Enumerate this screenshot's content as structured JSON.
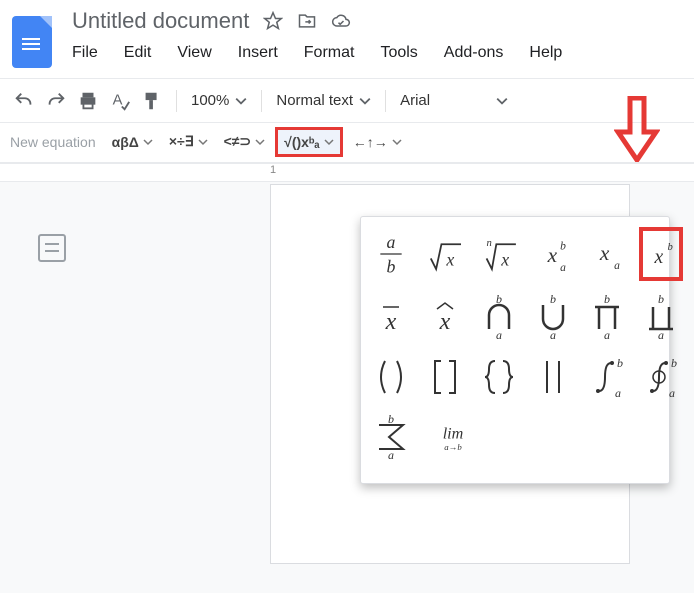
{
  "header": {
    "title": "Untitled document",
    "menu": [
      "File",
      "Edit",
      "View",
      "Insert",
      "Format",
      "Tools",
      "Add-ons",
      "Help"
    ]
  },
  "toolbar": {
    "zoom": "100%",
    "paragraph_style": "Normal text",
    "font": "Arial"
  },
  "equation_toolbar": {
    "new_equation": "New equation",
    "greek": "αβΔ",
    "operators": "×÷∃",
    "relations": "<≠⊃",
    "math_group": "√()xᵇₐ",
    "arrows": "←↑→"
  },
  "ruler": {
    "mark": "1"
  },
  "math_dropdown": {
    "row1": [
      "frac_ab",
      "sqrt_x",
      "nthroot_x",
      "x_sub_sup",
      "x_sub",
      "x_sup"
    ],
    "row2": [
      "x_bar",
      "x_hat",
      "bigcap",
      "bigcup",
      "prod",
      "coprod"
    ],
    "row3": [
      "parens",
      "brackets",
      "braces",
      "bars",
      "integral",
      "oint"
    ],
    "row4": [
      "sum",
      "lim"
    ]
  }
}
